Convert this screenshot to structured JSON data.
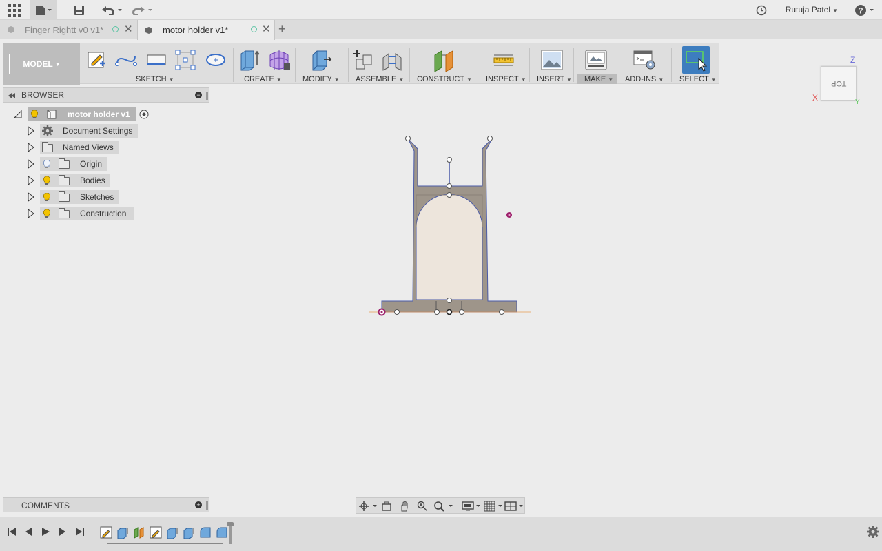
{
  "appbar": {
    "icons": [
      "apps-grid-icon",
      "file-icon",
      "save-icon",
      "undo-icon",
      "redo-icon",
      "history-clock-icon",
      "help-icon"
    ],
    "user_name": "Rutuja Patel"
  },
  "tabs": [
    {
      "label": "Finger Rightt v0 v1*",
      "active": false
    },
    {
      "label": "motor holder v1*",
      "active": true
    }
  ],
  "toolbar": {
    "model_label": "MODEL",
    "groups": {
      "sketch": "SKETCH",
      "create": "CREATE",
      "modify": "MODIFY",
      "assemble": "ASSEMBLE",
      "construct": "CONSTRUCT",
      "inspect": "INSPECT",
      "insert": "INSERT",
      "make": "MAKE",
      "addins": "ADD-INS",
      "select": "SELECT"
    }
  },
  "viewcube": {
    "face": "TOP",
    "axis_x": "X",
    "axis_y": "Y",
    "axis_z": "Z"
  },
  "browser": {
    "title": "BROWSER",
    "root": "motor holder v1",
    "items": [
      {
        "label": "Document Settings",
        "icon": "gear-icon"
      },
      {
        "label": "Named Views",
        "icon": "folder-icon"
      },
      {
        "label": "Origin",
        "icon": "folder-icon",
        "bulb": "off"
      },
      {
        "label": "Bodies",
        "icon": "folder-icon",
        "bulb": "on"
      },
      {
        "label": "Sketches",
        "icon": "folder-icon",
        "bulb": "on"
      },
      {
        "label": "Construction",
        "icon": "folder-icon",
        "bulb": "on"
      }
    ]
  },
  "comments": {
    "title": "COMMENTS"
  },
  "colors": {
    "accent_select": "#3d7dbf",
    "sketch_fill": "#9e958a",
    "arch_fill": "#ede5dc",
    "sketch_line": "#4a5aa8",
    "origin_point": "#9c1f6b",
    "bulb_on": "#f3c300"
  }
}
